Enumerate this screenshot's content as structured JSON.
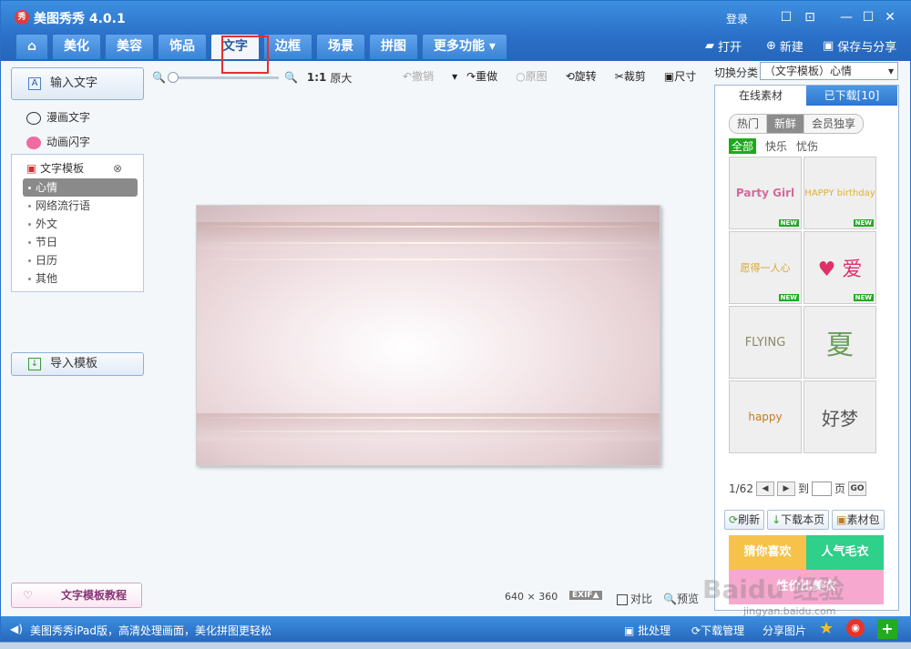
{
  "app": {
    "logo": "秀",
    "title": "美图秀秀 4.0.1",
    "login": "登录"
  },
  "window_controls": [
    "☐",
    "⊡",
    "—",
    "☐",
    "✕"
  ],
  "tabs": [
    {
      "label": "⌂"
    },
    {
      "label": "美化"
    },
    {
      "label": "美容"
    },
    {
      "label": "饰品"
    },
    {
      "label": "文字"
    },
    {
      "label": "边框"
    },
    {
      "label": "场景"
    },
    {
      "label": "拼图"
    },
    {
      "label": "更多功能 ▾"
    }
  ],
  "file_actions": {
    "open": "打开",
    "new": "新建",
    "save": "保存与分享"
  },
  "left": {
    "input_text": "输入文字",
    "comic_text": "漫画文字",
    "anim_text": "动画闪字",
    "template_head": "文字模板",
    "template_items": [
      "心情",
      "网络流行语",
      "外文",
      "节日",
      "日历",
      "其他"
    ],
    "import": "导入模板",
    "tutorial": "文字模板教程"
  },
  "zoom": {
    "fit": "1:1",
    "original": "原大"
  },
  "edit_tools": {
    "undo": "撤销",
    "redo": "重做",
    "orig": "原图",
    "rotate": "旋转",
    "crop": "裁剪",
    "size": "尺寸"
  },
  "canvas_info": {
    "width": "640",
    "x": "×",
    "height": "360",
    "exif": "EXIF▲",
    "compare": "对比",
    "preview": "预览"
  },
  "right": {
    "switch_label": "切换分类",
    "switch_value": "（文字模板）心情",
    "tab_online": "在线素材",
    "tab_downloaded": "已下载[10]",
    "chips": [
      "热门",
      "新鲜",
      "会员独享"
    ],
    "filters": [
      "全部",
      "快乐",
      "忧伤"
    ],
    "thumbs": [
      {
        "text": "Party Girl",
        "color": "#d36a9a",
        "new": "NEW"
      },
      {
        "text": "HAPPY birthday",
        "color": "#e0b030",
        "new": "NEW"
      },
      {
        "text": "愿得一人心",
        "color": "#d8a830",
        "new": "NEW"
      },
      {
        "text": "♥ 爱",
        "color": "#e0306a",
        "new": "NEW"
      },
      {
        "text": "FLYING",
        "color": "#8a8a6a",
        "new": ""
      },
      {
        "text": "夏",
        "color": "#6a9a5a",
        "new": ""
      },
      {
        "text": "happy",
        "color": "#c87a20",
        "new": ""
      },
      {
        "text": "好梦",
        "color": "#555555",
        "new": ""
      }
    ],
    "page": "1/62",
    "goto": "到",
    "page_unit": "页",
    "go": "GO",
    "refresh": "刷新",
    "download_page": "下载本页",
    "pack": "素材包",
    "ad1_left": "猜你喜欢",
    "ad1_right": "人气毛衣",
    "ad2": "性价比美衣"
  },
  "status": {
    "promo": "美图秀秀iPad版，高清处理画面，美化拼图更轻松",
    "batch": "批处理",
    "download_mgr": "下载管理",
    "share": "分享图片"
  },
  "watermark": {
    "text": "Baidu 经验",
    "url": "jingyan.baidu.com"
  }
}
